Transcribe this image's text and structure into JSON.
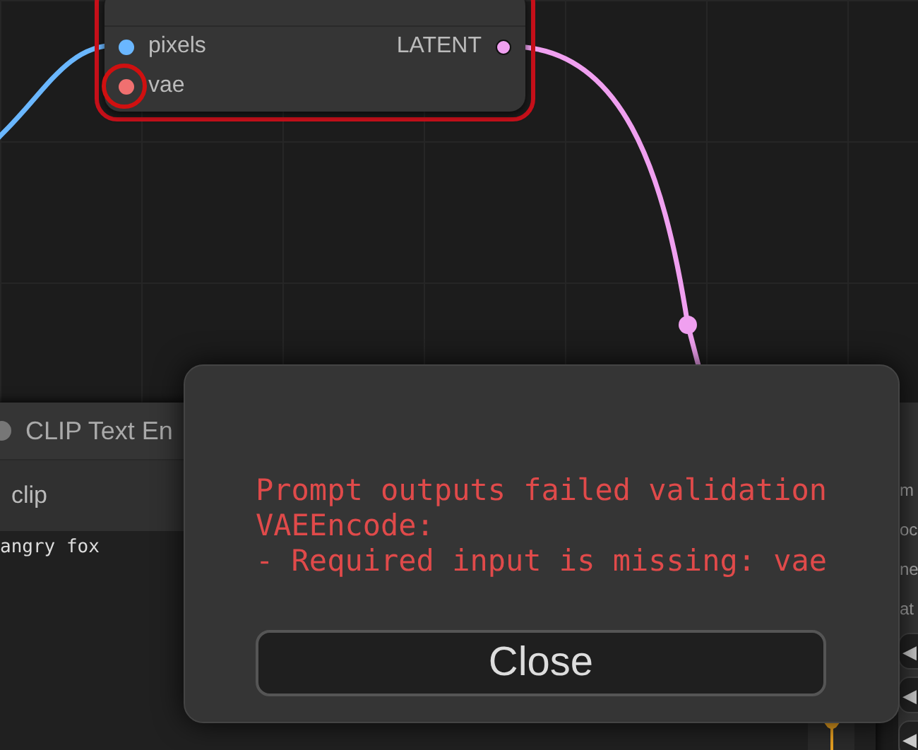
{
  "vae_encode_node": {
    "error": true,
    "inputs": [
      {
        "label": "pixels",
        "color": "#6ab7ff",
        "error": false
      },
      {
        "label": "vae",
        "color": "#f07070",
        "error": true
      }
    ],
    "outputs": [
      {
        "label": "LATENT",
        "color": "#f0a0f0"
      }
    ]
  },
  "clip_node": {
    "title": "CLIP Text En",
    "inputs": [
      {
        "label": "clip"
      }
    ],
    "prompt": "angry fox"
  },
  "side_node": {
    "widgets": [
      "m",
      "oc",
      "ne",
      "at"
    ],
    "arrows": [
      "◀",
      "◀",
      "◀"
    ]
  },
  "dialog": {
    "message_lines": [
      "Prompt outputs failed validation",
      "VAEEncode:",
      "- Required input is missing: vae"
    ],
    "button": "Close"
  }
}
